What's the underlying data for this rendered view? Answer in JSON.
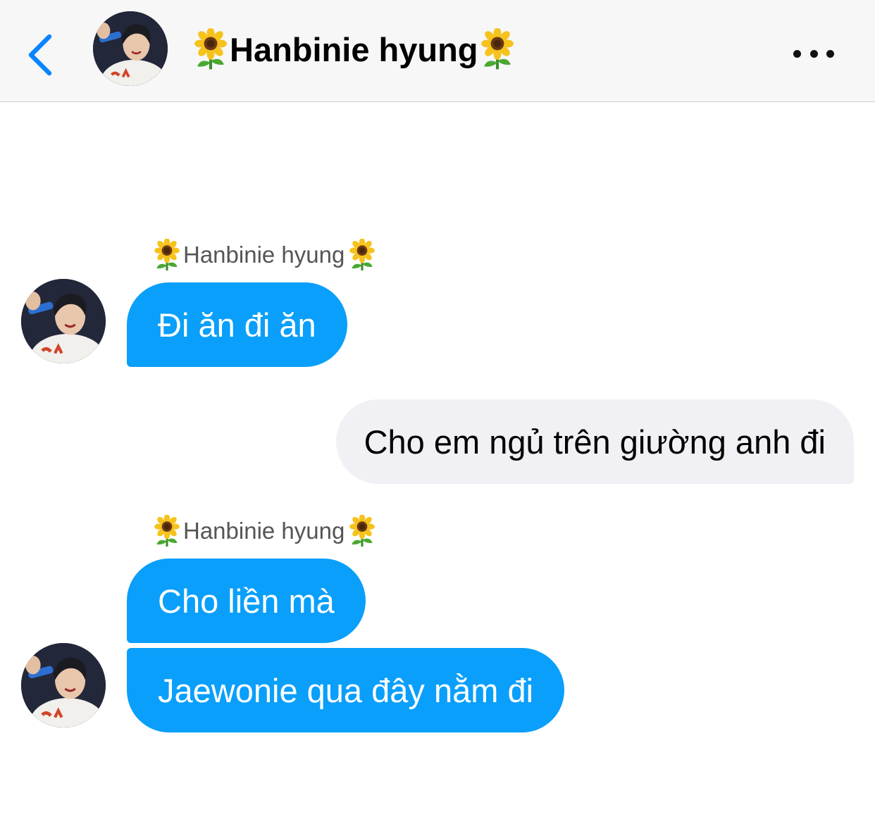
{
  "header": {
    "contact_name": "Hanbinie hyung",
    "back_icon": "chevron-left-icon",
    "more_icon": "more-horizontal-icon",
    "decor_icon": "sunflower-emoji"
  },
  "colors": {
    "accent": "#0a84ff",
    "incoming_bubble": "#0a9ffa",
    "outgoing_bubble": "#f1f1f5",
    "header_bg": "#f7f7f7"
  },
  "messages": [
    {
      "direction": "incoming",
      "sender": "Hanbinie hyung",
      "text": "Đi ăn đi ăn"
    },
    {
      "direction": "outgoing",
      "text": "Cho em ngủ trên giường anh đi"
    },
    {
      "direction": "incoming",
      "sender": "Hanbinie hyung",
      "text": "Cho liền mà"
    },
    {
      "direction": "incoming",
      "text": "Jaewonie qua đây nằm đi"
    }
  ]
}
